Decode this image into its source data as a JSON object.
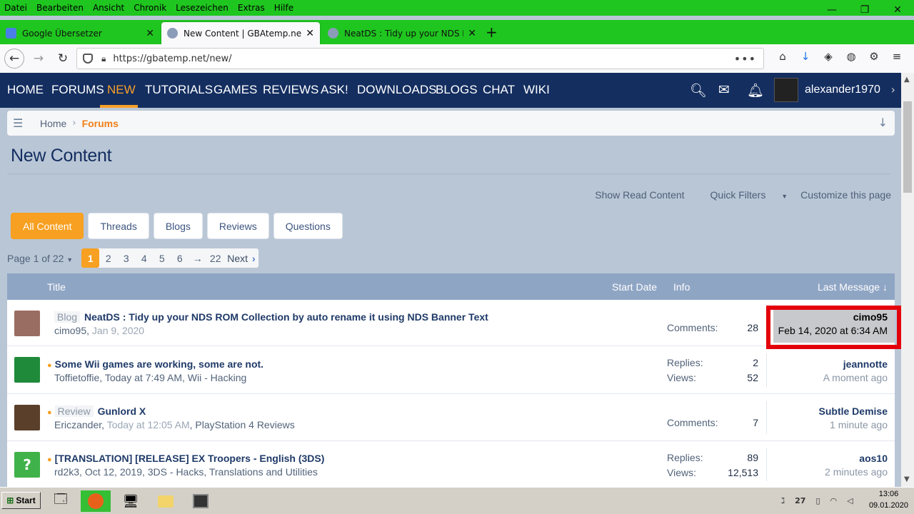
{
  "browser": {
    "menu": [
      "Datei",
      "Bearbeiten",
      "Ansicht",
      "Chronik",
      "Lesezeichen",
      "Extras",
      "Hilfe"
    ],
    "tabs": [
      {
        "title": "Google Übersetzer",
        "close": "✕"
      },
      {
        "title": "New Content | GBAtemp.net - T",
        "close": "✕"
      },
      {
        "title": "NeatDS : Tidy up your NDS ROM",
        "close": "✕"
      }
    ],
    "new_tab": "+",
    "url": "https://gbatemp.net/new/",
    "url_menu": "•••",
    "window_controls": [
      "—",
      "❐",
      "✕"
    ]
  },
  "site": {
    "nav": [
      "HOME",
      "FORUMS",
      "NEW",
      "TUTORIALS",
      "GAMES",
      "REVIEWS",
      "ASK!",
      "DOWNLOADS",
      "BLOGS",
      "CHAT",
      "WIKI"
    ],
    "active_nav": "NEW",
    "username": "alexander1970",
    "accent": "#f7a021",
    "header_bg": "#142e60"
  },
  "breadcrumb": {
    "home": "Home",
    "forums": "Forums"
  },
  "page_title": "New Content",
  "filters": {
    "show_read": "Show Read Content",
    "quick_filters": "Quick Filters",
    "customize": "Customize this page"
  },
  "content_tabs": [
    "All Content",
    "Threads",
    "Blogs",
    "Reviews",
    "Questions"
  ],
  "pager": {
    "info": "Page 1 of 22",
    "pages": [
      "1",
      "2",
      "3",
      "4",
      "5",
      "6",
      "→",
      "22"
    ],
    "next": "Next"
  },
  "table": {
    "headers": {
      "title": "Title",
      "start_date": "Start Date",
      "info": "Info",
      "last_message": "Last Message ↓"
    },
    "rows": [
      {
        "prefix": "Blog",
        "title": "NeatDS : Tidy up your NDS ROM Collection by auto rename it using NDS Banner Text",
        "author": "cimo95,",
        "date": "Jan 9, 2020",
        "forum": "",
        "info1_label": "Comments:",
        "info1_value": "28",
        "info2_label": "",
        "info2_value": "",
        "last_user": "cimo95",
        "last_time": "Feb 14, 2020 at 6:34 AM"
      },
      {
        "prefix": "",
        "title": "Some Wii games are working, some are not.",
        "author": "Toffietoffie,",
        "date": "Today at 7:49 AM",
        "forum": ", Wii - Hacking",
        "info1_label": "Replies:",
        "info1_value": "2",
        "info2_label": "Views:",
        "info2_value": "52",
        "last_user": "jeannotte",
        "last_time": "A moment ago"
      },
      {
        "prefix": "Review",
        "title": "Gunlord X",
        "author": "Ericzander,",
        "date": "Today at 12:05 AM",
        "forum": ", PlayStation 4 Reviews",
        "info1_label": "Comments:",
        "info1_value": "7",
        "info2_label": "",
        "info2_value": "",
        "last_user": "Subtle Demise",
        "last_time": "1 minute ago"
      },
      {
        "prefix": "",
        "title": "[TRANSLATION] [RELEASE] EX Troopers - English (3DS)",
        "author": "rd2k3,",
        "date": "Oct 12, 2019",
        "forum": ", 3DS - Hacks, Translations and Utilities",
        "info1_label": "Replies:",
        "info1_value": "89",
        "info2_label": "Views:",
        "info2_value": "12,513",
        "last_user": "aos10",
        "last_time": "2 minutes ago"
      }
    ]
  },
  "taskbar": {
    "start": "Start",
    "clock_time": "13:06",
    "clock_date": "09.01.2020",
    "tray_num": "27"
  }
}
